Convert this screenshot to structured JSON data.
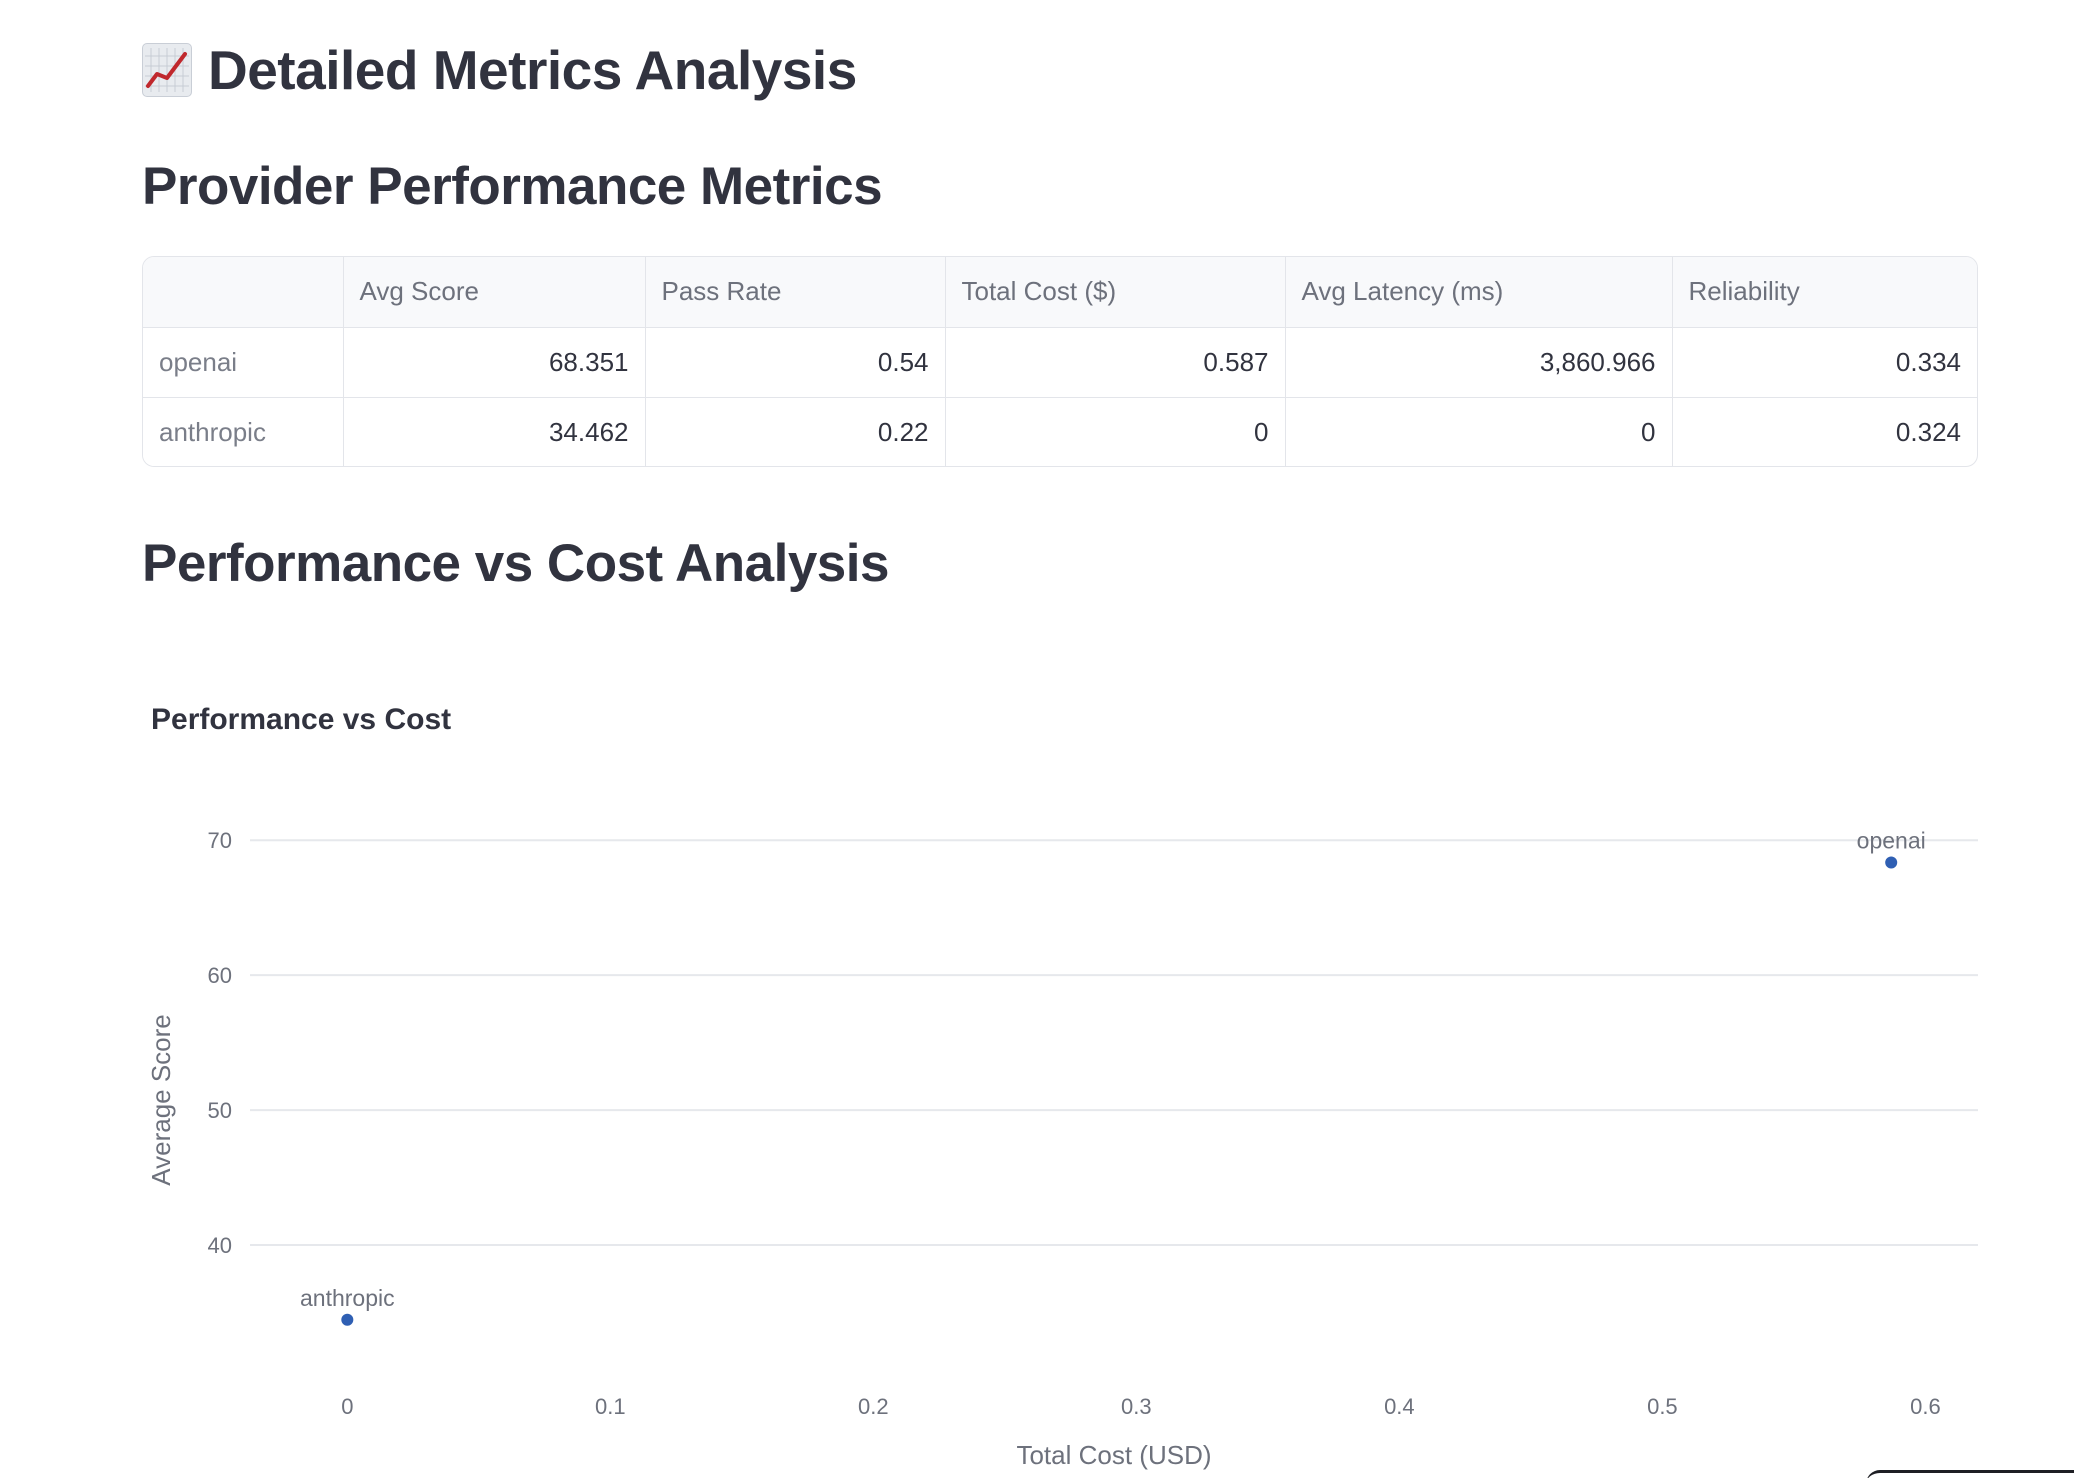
{
  "page": {
    "title": "📈 Detailed Metrics Analysis",
    "title_text": "Detailed Metrics Analysis",
    "title_icon": "chart-increasing-icon"
  },
  "metrics_section": {
    "heading": "Provider Performance Metrics",
    "table": {
      "columns": [
        "",
        "Avg Score",
        "Pass Rate",
        "Total Cost ($)",
        "Avg Latency (ms)",
        "Reliability"
      ],
      "rows": [
        {
          "provider": "openai",
          "cells": [
            "68.351",
            "0.54",
            "0.587",
            "3,860.966",
            "0.334"
          ]
        },
        {
          "provider": "anthropic",
          "cells": [
            "34.462",
            "0.22",
            "0",
            "0",
            "0.324"
          ]
        }
      ]
    }
  },
  "analysis_section": {
    "heading": "Performance vs Cost Analysis"
  },
  "chart_data": {
    "type": "scatter",
    "title": "Performance vs Cost",
    "xlabel": "Total Cost (USD)",
    "ylabel": "Average Score",
    "xlim": [
      -0.037,
      0.62
    ],
    "ylim": [
      30,
      71.5
    ],
    "xticks": [
      0,
      0.1,
      0.2,
      0.3,
      0.4,
      0.5,
      0.6
    ],
    "yticks": [
      40,
      50,
      60,
      70
    ],
    "grid": "horizontal",
    "points": [
      {
        "label": "openai",
        "x": 0.587,
        "y": 68.351
      },
      {
        "label": "anthropic",
        "x": 0,
        "y": 34.462
      }
    ],
    "marker_color": "#2f5fb3"
  }
}
